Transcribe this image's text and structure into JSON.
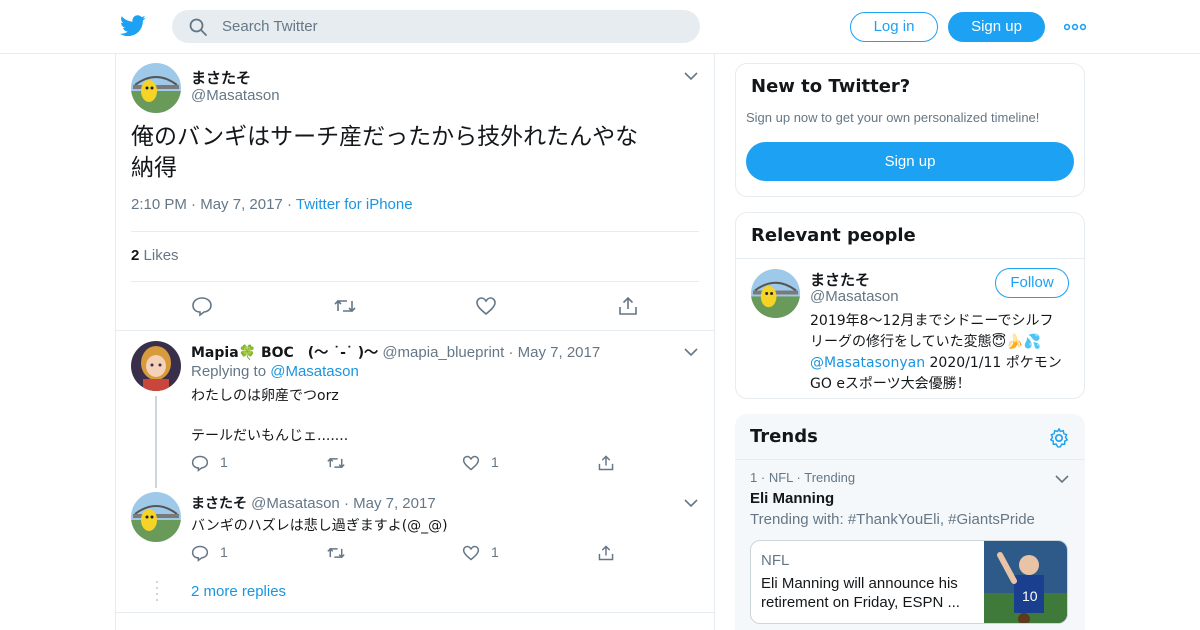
{
  "header": {
    "search_placeholder": "Search Twitter",
    "login_label": "Log in",
    "signup_label": "Sign up"
  },
  "tweet": {
    "author_name": "まさたそ",
    "author_handle": "@Masatason",
    "text_line1": "俺のバンギはサーチ産だったから技外れたんやな",
    "text_line2": "納得",
    "time": "2:10 PM",
    "date": "May 7, 2017",
    "source": "Twitter for iPhone",
    "likes_count": "2",
    "likes_label": "Likes"
  },
  "replies": [
    {
      "author_name": "Mapia🍀 BOC　(～ ˙-˙ )～",
      "author_handle": "@mapia_blueprint",
      "date": "May 7, 2017",
      "replying_prefix": "Replying to",
      "replying_to": "@Masatason",
      "text_line1": "わたしのは卵産でつorz",
      "text_line2": "テールだいもんじェ.......",
      "reply_count": "1",
      "like_count": "1"
    },
    {
      "author_name": "まさたそ",
      "author_handle": "@Masatason",
      "date": "May 7, 2017",
      "text_line1": "バンギのハズレは悲し過ぎますよ(@_@)",
      "reply_count": "1",
      "like_count": "1"
    }
  ],
  "more_replies": "2 more replies",
  "sidebar": {
    "new_title": "New to Twitter?",
    "new_subtitle": "Sign up now to get your own personalized timeline!",
    "new_signup": "Sign up",
    "relevant_title": "Relevant people",
    "person": {
      "name": "まさたそ",
      "handle": "@Masatason",
      "follow_label": "Follow",
      "bio_line1": "2019年8〜12月までシドニーでシルフ",
      "bio_line2": "リーグの修行をしていた変態😇🍌💦",
      "bio_mention": "@Masatasonyan",
      "bio_line3_rest": " 2020/1/11 ポケモン",
      "bio_line4": "GO eスポーツ大会優勝！"
    },
    "trends_title": "Trends",
    "trend": {
      "rank": "1",
      "category": "NFL",
      "status": "Trending",
      "name": "Eli Manning",
      "with_text": "Trending with: #ThankYouEli, #GiantsPride"
    },
    "news": {
      "source": "NFL",
      "text": "Eli Manning will announce his retirement on Friday, ESPN ..."
    }
  },
  "colors": {
    "accent": "#1da1f2",
    "link": "#1b95e0",
    "muted": "#657786",
    "border": "#e6ecf0"
  }
}
